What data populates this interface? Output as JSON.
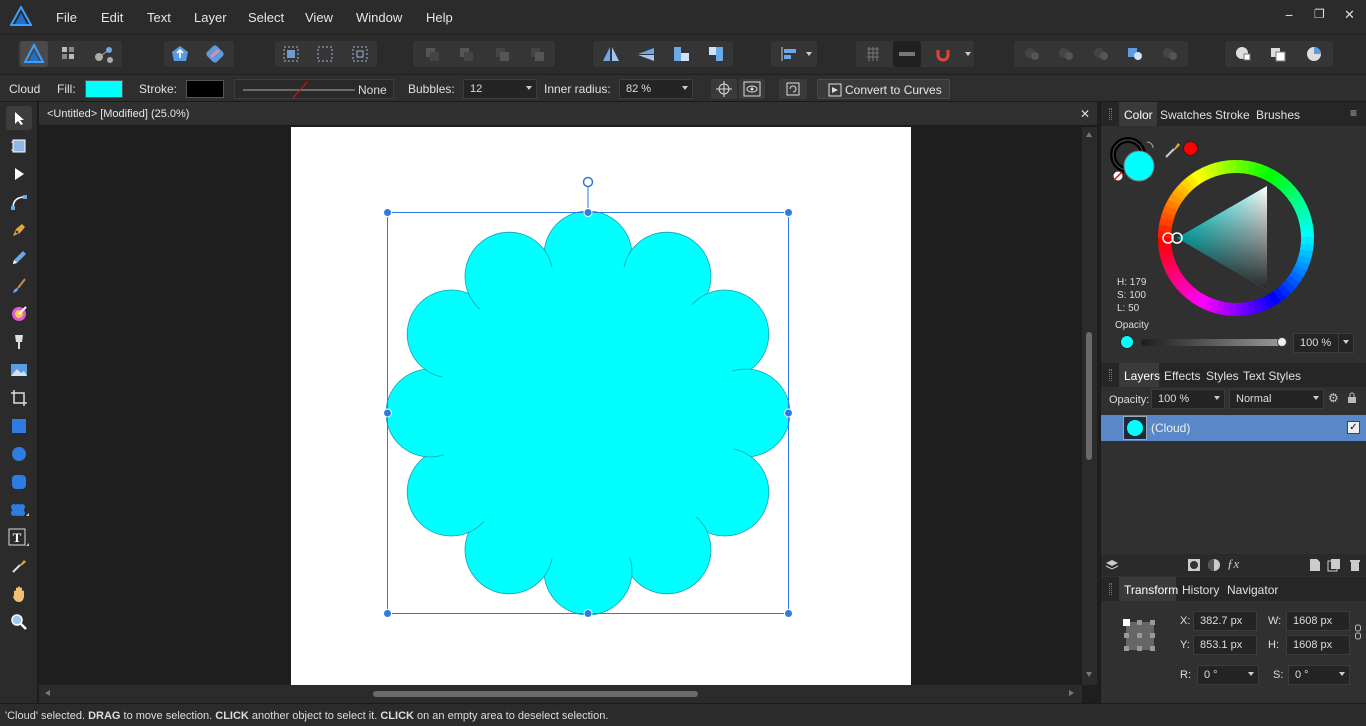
{
  "menu": {
    "items": [
      "File",
      "Edit",
      "Text",
      "Layer",
      "Select",
      "View",
      "Window",
      "Help"
    ]
  },
  "window_controls": {
    "minimize": "−",
    "restore": "❐",
    "close": "✕"
  },
  "context_bar": {
    "tool_name": "Cloud",
    "fill_label": "Fill:",
    "fill_color": "#00ffff",
    "stroke_label": "Stroke:",
    "stroke_color": "#000000",
    "stroke_style": "None",
    "bubbles_label": "Bubbles:",
    "bubbles_value": "12",
    "inner_radius_label": "Inner radius:",
    "inner_radius_value": "82 %",
    "convert_button": "Convert to Curves"
  },
  "document": {
    "tab_title": "<Untitled> [Modified] (25.0%)",
    "close": "✕",
    "shape_fill": "#00ffff",
    "selection_color": "#2f7be0"
  },
  "color_panel": {
    "tabs": [
      "Color",
      "Swatches",
      "Stroke",
      "Brushes"
    ],
    "h": "H: 179",
    "s": "S: 100",
    "l": "L: 50",
    "opacity_label": "Opacity",
    "opacity_value": "100 %",
    "current_color": "#00ffff",
    "secondary_color": "#ff0000"
  },
  "layers_panel": {
    "tabs": [
      "Layers",
      "Effects",
      "Styles",
      "Text Styles"
    ],
    "opacity_label": "Opacity:",
    "opacity_value": "100 %",
    "blend_mode": "Normal",
    "layer_name": "(Cloud)",
    "layer_checkbox": "✓"
  },
  "transform_panel": {
    "tabs": [
      "Transform",
      "History",
      "Navigator"
    ],
    "x_label": "X:",
    "x_value": "382.7 px",
    "y_label": "Y:",
    "y_value": "853.1 px",
    "w_label": "W:",
    "w_value": "1608 px",
    "h_label": "H:",
    "h_value": "1608 px",
    "r_label": "R:",
    "r_value": "0 °",
    "s_label": "S:",
    "s_value": "0 °"
  },
  "status": {
    "part1": "'Cloud' selected. ",
    "part2": "DRAG",
    "part3": " to move selection. ",
    "part4": "CLICK",
    "part5": " another object to select it. ",
    "part6": "CLICK",
    "part7": " on an empty area to deselect selection."
  },
  "annotation": {
    "arrow_color": "#e01010"
  },
  "tools": [
    "move-tool-icon",
    "artboard-tool-icon",
    "node-tool-icon",
    "corner-tool-icon",
    "pen-tool-icon",
    "pencil-tool-icon",
    "vector-brush-icon",
    "fill-tool-icon",
    "transparency-tool-icon",
    "place-image-icon",
    "crop-tool-icon",
    "rectangle-tool-icon",
    "ellipse-tool-icon",
    "rounded-rectangle-icon",
    "cloud-shape-tool-icon",
    "artistic-text-icon",
    "color-picker-icon",
    "view-hand-icon",
    "zoom-tool-icon"
  ]
}
